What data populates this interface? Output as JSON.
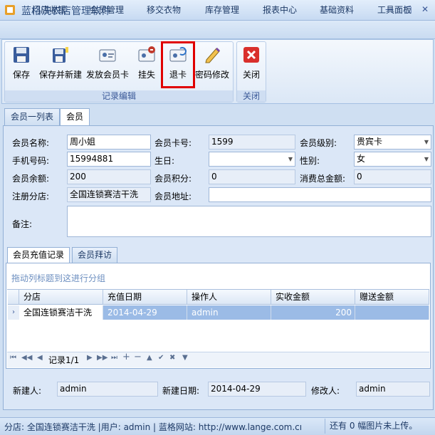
{
  "window": {
    "title": "蓝格洗衣店管理软件",
    "min_icon": "minimize-icon",
    "max_icon": "maximize-icon",
    "close_icon": "close-icon",
    "min_glyph": "—",
    "max_glyph": "□",
    "close_glyph": "✕"
  },
  "menu": {
    "tabs": [
      "门店收银",
      "会员管理",
      "移交衣物",
      "库存管理",
      "报表中心",
      "基础资料",
      "工具面板"
    ]
  },
  "ribbon": {
    "group_edit_label": "记录编辑",
    "group_close_label": "关闭",
    "buttons": {
      "save": "保存",
      "save_new": "保存并新建",
      "issue_card": "发放会员卡",
      "report_loss": "挂失",
      "return_card": "退卡",
      "change_password": "密码修改",
      "close": "关闭"
    }
  },
  "page_tabs": {
    "list": "会员一列表",
    "member": "会员"
  },
  "form": {
    "name_label": "会员名称:",
    "name_value": "周小姐",
    "card_no_label": "会员卡号:",
    "card_no_value": "1599",
    "level_label": "会员级别:",
    "level_value": "贵宾卡",
    "phone_label": "手机号码:",
    "phone_value": "15994881",
    "birthday_label": "生日:",
    "birthday_value": "",
    "gender_label": "性别:",
    "gender_value": "女",
    "balance_label": "会员余额:",
    "balance_value": "200",
    "points_label": "会员积分:",
    "points_value": "0",
    "total_spend_label": "消费总金额:",
    "total_spend_value": "0",
    "branch_label": "注册分店:",
    "branch_value": "全国连锁赛洁干洗",
    "address_label": "会员地址:",
    "address_value": "",
    "notes_label": "备注:",
    "notes_value": ""
  },
  "sub_tabs": {
    "recharge": "会员充值记录",
    "visits": "会员拜访"
  },
  "grid": {
    "group_hint": "拖动列标题到这进行分组",
    "columns": [
      "分店",
      "充值日期",
      "操作人",
      "实收金额",
      "赠送金额"
    ],
    "rows": [
      [
        "全国连锁赛洁干洗",
        "2014-04-29",
        "admin",
        "200",
        ""
      ]
    ],
    "row_indicator": "›"
  },
  "navigator": {
    "record_text": "记录1/1",
    "first": "⏮",
    "prev_page": "◀◀",
    "prev": "◀",
    "next": "▶",
    "next_page": "▶▶",
    "last": "⏭",
    "add": "+",
    "remove": "−",
    "up": "▲",
    "check": "✔",
    "cancel": "✖",
    "down": "▼"
  },
  "footer": {
    "creator_label": "新建人:",
    "creator_value": "admin",
    "created_date_label": "新建日期:",
    "created_date_value": "2014-04-29",
    "modifier_label": "修改人:",
    "modifier_value": "admin"
  },
  "status": {
    "left": "分店: 全国连锁赛洁干洗  |用户: admin  |  蓝格网站:  http://www.lange.com.cı",
    "right": "还有 0 幅图片未上传。"
  },
  "colors": {
    "accent": "#3b5998",
    "highlight": "#e00000",
    "selected_row": "#9bbbe6"
  }
}
